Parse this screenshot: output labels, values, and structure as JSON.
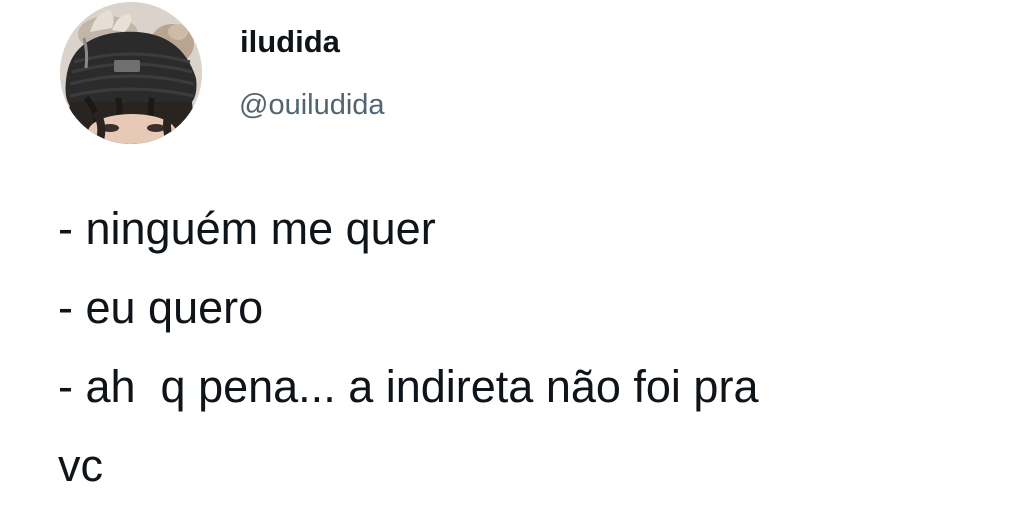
{
  "author": {
    "display_name": "iludida",
    "handle": "@ouiludida",
    "avatar_icon": "profile-photo"
  },
  "tweet": {
    "lines": [
      "- ninguém me quer",
      "- eu quero",
      "- ah  q pena... a indireta não foi pra",
      "vc"
    ]
  },
  "colors": {
    "text": "#0f1419",
    "handle": "#536471",
    "background": "#ffffff"
  }
}
